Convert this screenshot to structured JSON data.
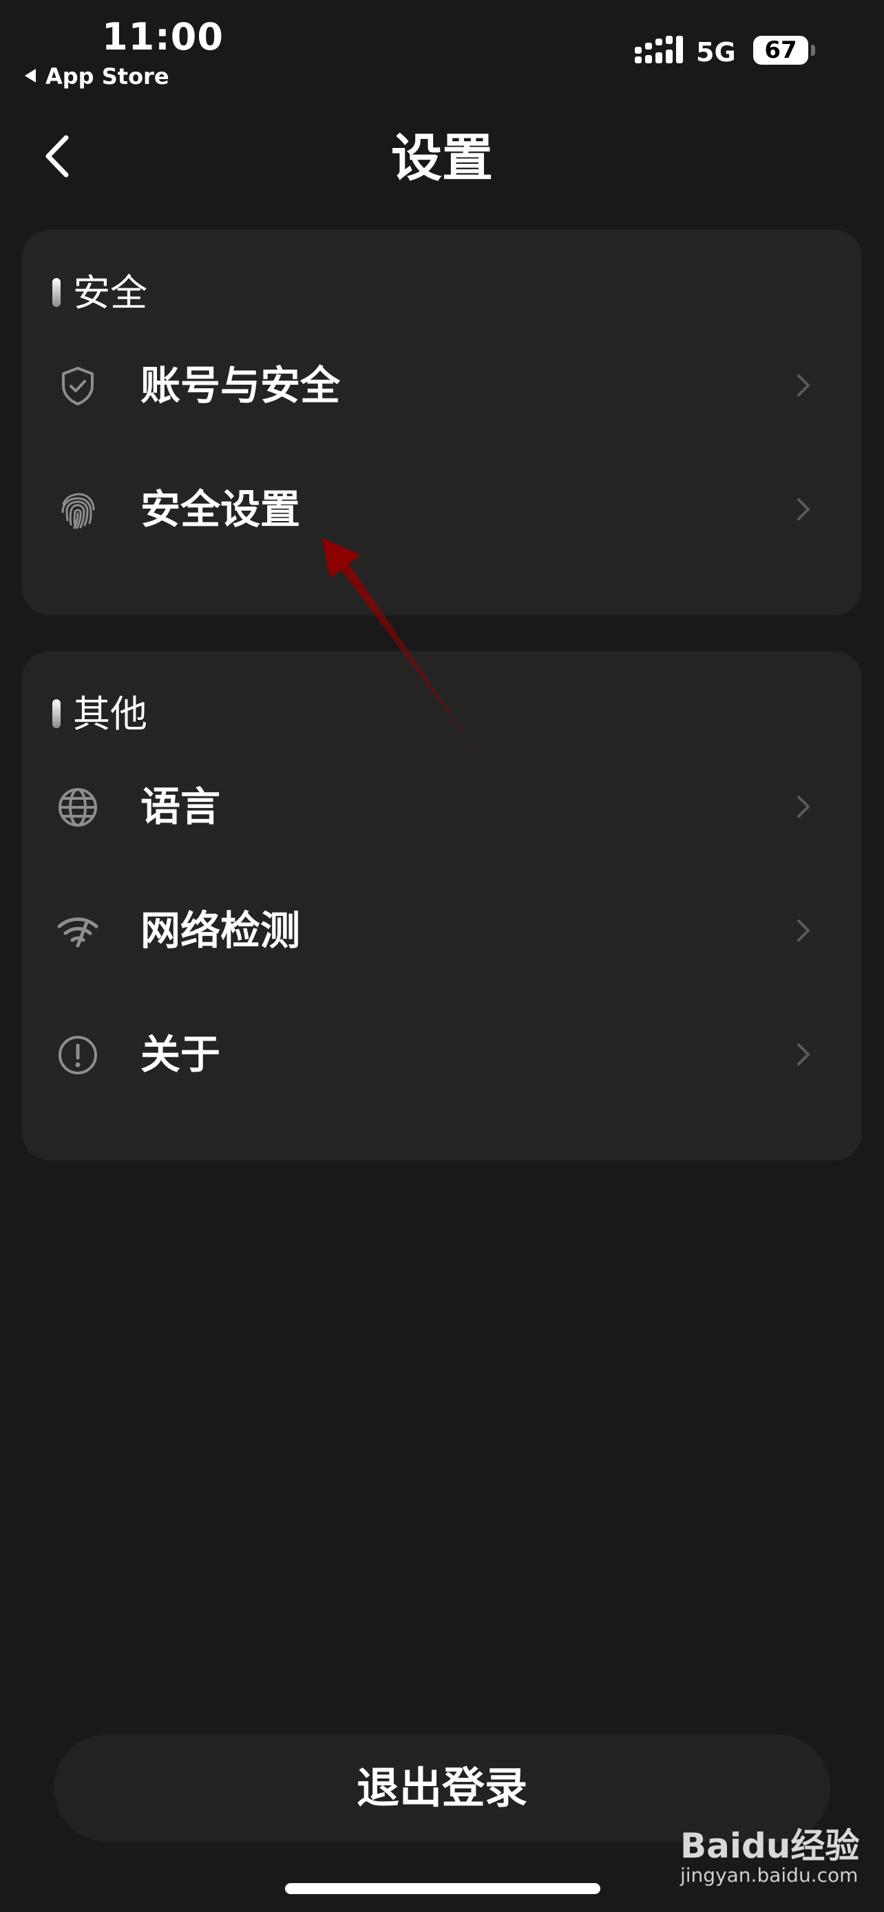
{
  "status_bar": {
    "time": "11:00",
    "back_app": "App Store",
    "network": "5G",
    "battery": "67"
  },
  "nav": {
    "title": "设置"
  },
  "sections": [
    {
      "title": "安全",
      "items": [
        {
          "label": "账号与安全",
          "icon": "shield-check-icon"
        },
        {
          "label": "安全设置",
          "icon": "fingerprint-icon"
        }
      ]
    },
    {
      "title": "其他",
      "items": [
        {
          "label": "语言",
          "icon": "globe-icon"
        },
        {
          "label": "网络检测",
          "icon": "wifi-speed-icon"
        },
        {
          "label": "关于",
          "icon": "info-exclamation-icon"
        }
      ]
    }
  ],
  "logout_label": "退出登录",
  "watermark": {
    "brand": "Baidu经验",
    "url": "jingyan.baidu.com"
  },
  "colors": {
    "background": "#191919",
    "card": "#242424",
    "annotation_arrow": "#8b0000"
  }
}
